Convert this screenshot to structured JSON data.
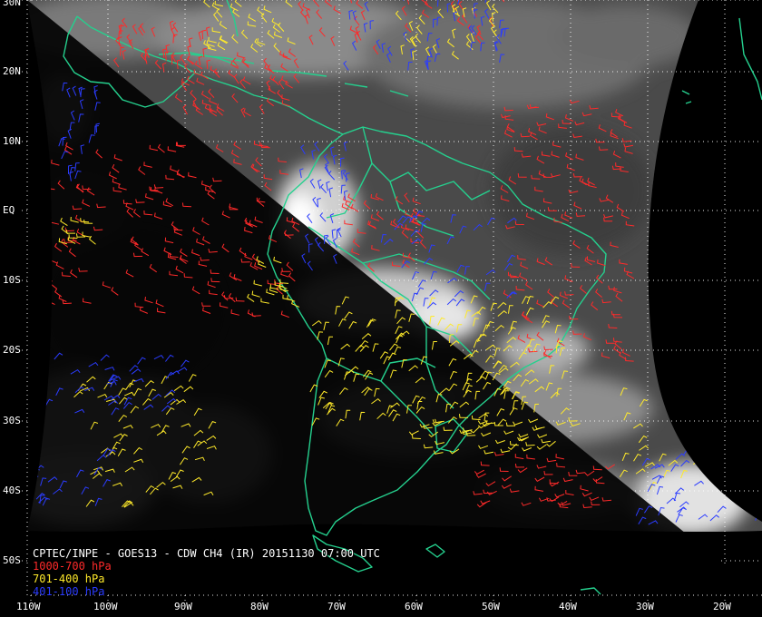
{
  "caption": {
    "title": "CPTEC/INPE - GOES13 - CDW CH4 (IR) 20151130 07:00 UTC",
    "legend": [
      {
        "label": "1000-700 hPa",
        "color": "#ff2a2a"
      },
      {
        "label": "701-400 hPa",
        "color": "#ffea2a"
      },
      {
        "label": "401-100 hPa",
        "color": "#2b3cff"
      }
    ]
  },
  "lat_labels": [
    "30N",
    "20N",
    "10N",
    "EQ",
    "10S",
    "20S",
    "30S",
    "40S",
    "50S"
  ],
  "lon_labels": [
    "110W",
    "100W",
    "90W",
    "80W",
    "70W",
    "60W",
    "50W",
    "40W",
    "30W",
    "20W"
  ],
  "colors": {
    "background": "#000000",
    "coastline": "#25d08e",
    "graticule": "#ffffff",
    "wind_low": "#ff2a2a",
    "wind_mid": "#ffea2a",
    "wind_high": "#2b3cff"
  }
}
